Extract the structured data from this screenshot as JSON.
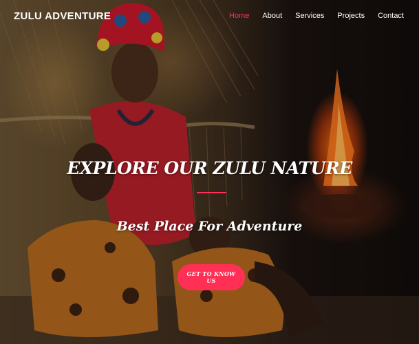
{
  "brand": {
    "name": "ZULU ADVENTURE"
  },
  "nav": {
    "items": [
      {
        "label": "Home",
        "active": true
      },
      {
        "label": "About"
      },
      {
        "label": "Services"
      },
      {
        "label": "Projects"
      },
      {
        "label": "Contact"
      }
    ]
  },
  "hero": {
    "title": "EXPLORE OUR ZULU NATURE",
    "subtitle": "Best Place For Adventure",
    "cta_label": "GET TO KNOW US",
    "background_image": "photo of a woman in a red and beaded headdress with two children beside a straw hut and an open fire"
  },
  "colors": {
    "accent": "#ff2f55",
    "text": "#ffffff"
  }
}
